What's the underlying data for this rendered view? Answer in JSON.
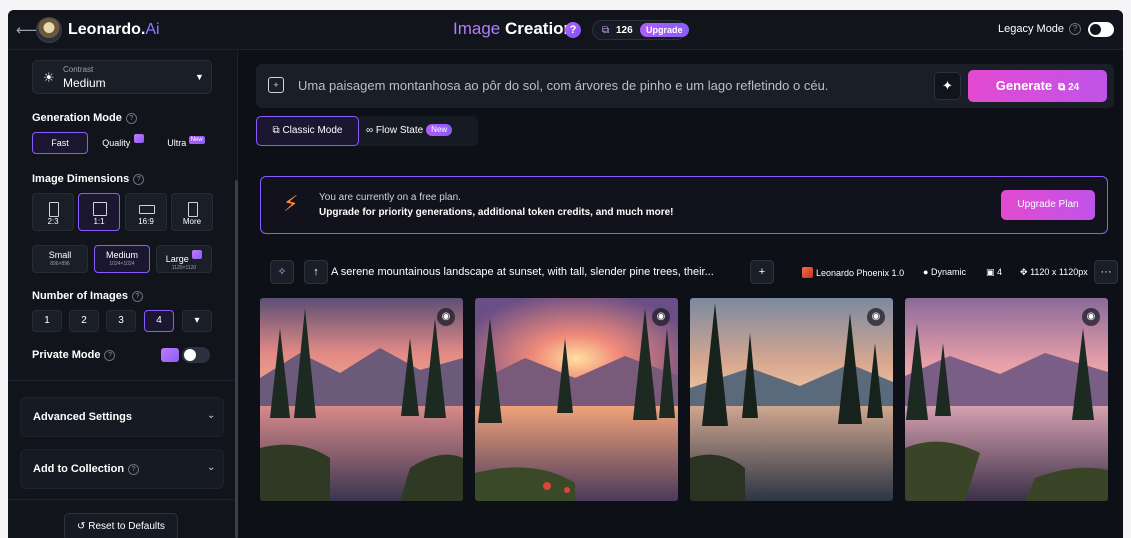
{
  "header": {
    "brand": "Leonardo.",
    "brand_suffix": "Ai",
    "title_prefix": "Image",
    "title_main": "Creation",
    "help": "?",
    "tokens": "126",
    "upgrade": "Upgrade",
    "legacy_label": "Legacy Mode",
    "legacy_on": false
  },
  "sidebar": {
    "contrast": {
      "label": "Contrast",
      "value": "Medium"
    },
    "generation_mode": {
      "title": "Generation Mode",
      "options": [
        "Fast",
        "Quality",
        "Ultra"
      ],
      "selected": "Fast",
      "new_tag": "New"
    },
    "image_dimensions": {
      "title": "Image Dimensions",
      "ratios": [
        "2:3",
        "1:1",
        "16:9",
        "More"
      ],
      "selected_ratio": "1:1",
      "sizes": [
        {
          "label": "Small",
          "dims": "896×896"
        },
        {
          "label": "Medium",
          "dims": "1024×1024"
        },
        {
          "label": "Large",
          "dims": "1120×1120"
        }
      ],
      "selected_size": "Medium"
    },
    "number_of_images": {
      "title": "Number of Images",
      "options": [
        "1",
        "2",
        "3",
        "4"
      ],
      "selected": "4"
    },
    "private_mode": {
      "label": "Private Mode",
      "enabled": false
    },
    "advanced_settings": "Advanced Settings",
    "add_to_collection": "Add to Collection",
    "reset": "Reset to Defaults"
  },
  "prompt": {
    "text": "Uma paisagem montanhosa ao pôr do sol, com árvores de pinho e um lago refletindo o céu.",
    "generate_label": "Generate",
    "generate_cost": "24"
  },
  "modes": {
    "classic": "Classic Mode",
    "flow": "Flow State",
    "flow_tag": "New"
  },
  "banner": {
    "line1": "You are currently on a free plan.",
    "line2": "Upgrade for priority generations, additional token credits, and much more!",
    "button": "Upgrade Plan"
  },
  "generation": {
    "prompt": "A serene mountainous landscape at sunset, with tall, slender pine trees, their...",
    "model": "Leonardo Phoenix 1.0",
    "style": "Dynamic",
    "count": "4",
    "size": "1120 x 1120px",
    "more": "···"
  },
  "colors": {
    "accent": "#8a5cff",
    "generate_gradient_start": "#e24ad0",
    "generate_gradient_end": "#c054e8"
  }
}
